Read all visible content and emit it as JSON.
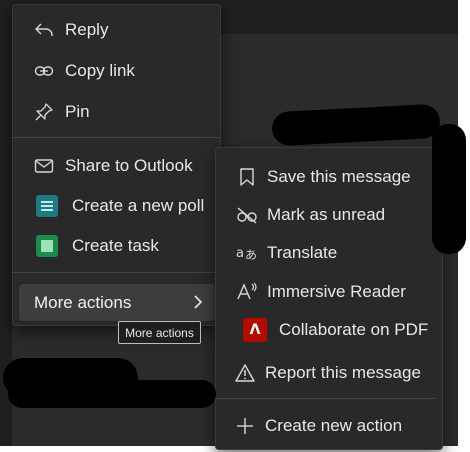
{
  "primary_menu": {
    "items": [
      {
        "label": "Reply",
        "icon": "reply-icon"
      },
      {
        "label": "Copy link",
        "icon": "link-icon"
      },
      {
        "label": "Pin",
        "icon": "pin-icon"
      },
      {
        "label": "Share to Outlook",
        "icon": "mail-icon"
      },
      {
        "label": "Create a new poll",
        "icon": "poll-app-icon"
      },
      {
        "label": "Create task",
        "icon": "task-app-icon"
      }
    ],
    "more_actions": {
      "label": "More actions",
      "icon": "chevron-right-icon"
    }
  },
  "tooltip": {
    "text": "More actions"
  },
  "submenu": {
    "items": [
      {
        "label": "Save this message",
        "icon": "bookmark-icon"
      },
      {
        "label": "Mark as unread",
        "icon": "eye-off-icon"
      },
      {
        "label": "Translate",
        "icon": "translate-icon"
      },
      {
        "label": "Immersive Reader",
        "icon": "immersive-reader-icon"
      },
      {
        "label": "Collaborate on PDF",
        "icon": "pdf-icon"
      },
      {
        "label": "Report this message",
        "icon": "warning-icon"
      },
      {
        "label": "Create new action",
        "icon": "plus-icon"
      }
    ]
  },
  "colors": {
    "menu_bg": "#292929",
    "highlight_bg": "#3d3d3d",
    "text": "#e8e8e8",
    "pdf_red": "#b30b00",
    "poll_teal": "#1f7a84",
    "task_green": "#1e8a4c"
  }
}
